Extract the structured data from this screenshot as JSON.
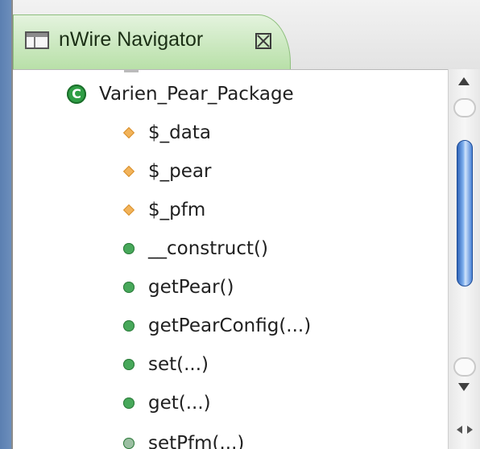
{
  "tab": {
    "title": "nWire Navigator"
  },
  "tree": {
    "root": {
      "label": "Varien_Pear_Package",
      "icon": "class-icon"
    },
    "children": [
      {
        "label": "$_data",
        "icon": "field-icon"
      },
      {
        "label": "$_pear",
        "icon": "field-icon"
      },
      {
        "label": "$_pfm",
        "icon": "field-icon"
      },
      {
        "label": "__construct()",
        "icon": "method-icon"
      },
      {
        "label": "getPear()",
        "icon": "method-icon"
      },
      {
        "label": "getPearConfig(...)",
        "icon": "method-icon"
      },
      {
        "label": "set(...)",
        "icon": "method-icon"
      },
      {
        "label": "get(...)",
        "icon": "method-icon"
      },
      {
        "label": "setPfm(...)",
        "icon": "method-icon"
      }
    ]
  },
  "colors": {
    "tab_green": "#b8e0a8",
    "class_icon": "#2f9e45",
    "field_icon": "#f2b35a",
    "scroll_thumb": "#4a83d6"
  }
}
